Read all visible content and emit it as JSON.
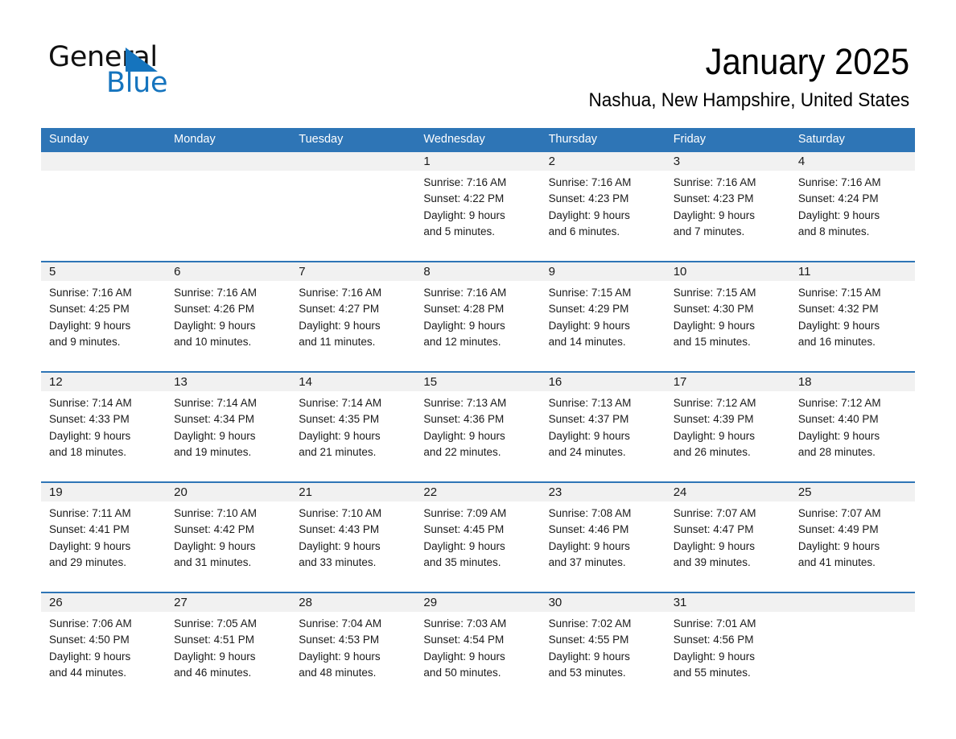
{
  "logo": {
    "word_general": "General",
    "word_blue": "Blue",
    "triangle_color": "#1574BE"
  },
  "header": {
    "month_title": "January 2025",
    "location": "Nashua, New Hampshire, United States"
  },
  "theme": {
    "header_blue": "#2E75B6",
    "daynum_bg": "#F1F1F1",
    "text": "#1a1a1a"
  },
  "weekdays": [
    "Sunday",
    "Monday",
    "Tuesday",
    "Wednesday",
    "Thursday",
    "Friday",
    "Saturday"
  ],
  "weeks": [
    [
      {
        "day": "",
        "lines": []
      },
      {
        "day": "",
        "lines": []
      },
      {
        "day": "",
        "lines": []
      },
      {
        "day": "1",
        "lines": [
          "Sunrise: 7:16 AM",
          "Sunset: 4:22 PM",
          "Daylight: 9 hours",
          "and 5 minutes."
        ]
      },
      {
        "day": "2",
        "lines": [
          "Sunrise: 7:16 AM",
          "Sunset: 4:23 PM",
          "Daylight: 9 hours",
          "and 6 minutes."
        ]
      },
      {
        "day": "3",
        "lines": [
          "Sunrise: 7:16 AM",
          "Sunset: 4:23 PM",
          "Daylight: 9 hours",
          "and 7 minutes."
        ]
      },
      {
        "day": "4",
        "lines": [
          "Sunrise: 7:16 AM",
          "Sunset: 4:24 PM",
          "Daylight: 9 hours",
          "and 8 minutes."
        ]
      }
    ],
    [
      {
        "day": "5",
        "lines": [
          "Sunrise: 7:16 AM",
          "Sunset: 4:25 PM",
          "Daylight: 9 hours",
          "and 9 minutes."
        ]
      },
      {
        "day": "6",
        "lines": [
          "Sunrise: 7:16 AM",
          "Sunset: 4:26 PM",
          "Daylight: 9 hours",
          "and 10 minutes."
        ]
      },
      {
        "day": "7",
        "lines": [
          "Sunrise: 7:16 AM",
          "Sunset: 4:27 PM",
          "Daylight: 9 hours",
          "and 11 minutes."
        ]
      },
      {
        "day": "8",
        "lines": [
          "Sunrise: 7:16 AM",
          "Sunset: 4:28 PM",
          "Daylight: 9 hours",
          "and 12 minutes."
        ]
      },
      {
        "day": "9",
        "lines": [
          "Sunrise: 7:15 AM",
          "Sunset: 4:29 PM",
          "Daylight: 9 hours",
          "and 14 minutes."
        ]
      },
      {
        "day": "10",
        "lines": [
          "Sunrise: 7:15 AM",
          "Sunset: 4:30 PM",
          "Daylight: 9 hours",
          "and 15 minutes."
        ]
      },
      {
        "day": "11",
        "lines": [
          "Sunrise: 7:15 AM",
          "Sunset: 4:32 PM",
          "Daylight: 9 hours",
          "and 16 minutes."
        ]
      }
    ],
    [
      {
        "day": "12",
        "lines": [
          "Sunrise: 7:14 AM",
          "Sunset: 4:33 PM",
          "Daylight: 9 hours",
          "and 18 minutes."
        ]
      },
      {
        "day": "13",
        "lines": [
          "Sunrise: 7:14 AM",
          "Sunset: 4:34 PM",
          "Daylight: 9 hours",
          "and 19 minutes."
        ]
      },
      {
        "day": "14",
        "lines": [
          "Sunrise: 7:14 AM",
          "Sunset: 4:35 PM",
          "Daylight: 9 hours",
          "and 21 minutes."
        ]
      },
      {
        "day": "15",
        "lines": [
          "Sunrise: 7:13 AM",
          "Sunset: 4:36 PM",
          "Daylight: 9 hours",
          "and 22 minutes."
        ]
      },
      {
        "day": "16",
        "lines": [
          "Sunrise: 7:13 AM",
          "Sunset: 4:37 PM",
          "Daylight: 9 hours",
          "and 24 minutes."
        ]
      },
      {
        "day": "17",
        "lines": [
          "Sunrise: 7:12 AM",
          "Sunset: 4:39 PM",
          "Daylight: 9 hours",
          "and 26 minutes."
        ]
      },
      {
        "day": "18",
        "lines": [
          "Sunrise: 7:12 AM",
          "Sunset: 4:40 PM",
          "Daylight: 9 hours",
          "and 28 minutes."
        ]
      }
    ],
    [
      {
        "day": "19",
        "lines": [
          "Sunrise: 7:11 AM",
          "Sunset: 4:41 PM",
          "Daylight: 9 hours",
          "and 29 minutes."
        ]
      },
      {
        "day": "20",
        "lines": [
          "Sunrise: 7:10 AM",
          "Sunset: 4:42 PM",
          "Daylight: 9 hours",
          "and 31 minutes."
        ]
      },
      {
        "day": "21",
        "lines": [
          "Sunrise: 7:10 AM",
          "Sunset: 4:43 PM",
          "Daylight: 9 hours",
          "and 33 minutes."
        ]
      },
      {
        "day": "22",
        "lines": [
          "Sunrise: 7:09 AM",
          "Sunset: 4:45 PM",
          "Daylight: 9 hours",
          "and 35 minutes."
        ]
      },
      {
        "day": "23",
        "lines": [
          "Sunrise: 7:08 AM",
          "Sunset: 4:46 PM",
          "Daylight: 9 hours",
          "and 37 minutes."
        ]
      },
      {
        "day": "24",
        "lines": [
          "Sunrise: 7:07 AM",
          "Sunset: 4:47 PM",
          "Daylight: 9 hours",
          "and 39 minutes."
        ]
      },
      {
        "day": "25",
        "lines": [
          "Sunrise: 7:07 AM",
          "Sunset: 4:49 PM",
          "Daylight: 9 hours",
          "and 41 minutes."
        ]
      }
    ],
    [
      {
        "day": "26",
        "lines": [
          "Sunrise: 7:06 AM",
          "Sunset: 4:50 PM",
          "Daylight: 9 hours",
          "and 44 minutes."
        ]
      },
      {
        "day": "27",
        "lines": [
          "Sunrise: 7:05 AM",
          "Sunset: 4:51 PM",
          "Daylight: 9 hours",
          "and 46 minutes."
        ]
      },
      {
        "day": "28",
        "lines": [
          "Sunrise: 7:04 AM",
          "Sunset: 4:53 PM",
          "Daylight: 9 hours",
          "and 48 minutes."
        ]
      },
      {
        "day": "29",
        "lines": [
          "Sunrise: 7:03 AM",
          "Sunset: 4:54 PM",
          "Daylight: 9 hours",
          "and 50 minutes."
        ]
      },
      {
        "day": "30",
        "lines": [
          "Sunrise: 7:02 AM",
          "Sunset: 4:55 PM",
          "Daylight: 9 hours",
          "and 53 minutes."
        ]
      },
      {
        "day": "31",
        "lines": [
          "Sunrise: 7:01 AM",
          "Sunset: 4:56 PM",
          "Daylight: 9 hours",
          "and 55 minutes."
        ]
      },
      {
        "day": "",
        "lines": []
      }
    ]
  ]
}
